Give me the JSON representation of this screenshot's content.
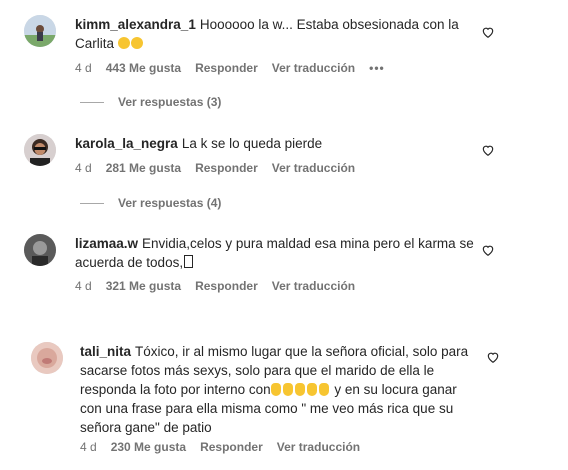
{
  "comments": [
    {
      "username": "kimm_alexandra_1",
      "text": "Hoooooo la w... Estaba obsesionada con la Carlita",
      "time": "4 d",
      "likes": "443 Me gusta",
      "reply": "Responder",
      "translate": "Ver traducción",
      "more": "•••",
      "view_replies": "Ver respuestas (3)"
    },
    {
      "username": "karola_la_negra",
      "text": "La k se lo queda pierde",
      "time": "4 d",
      "likes": "281 Me gusta",
      "reply": "Responder",
      "translate": "Ver traducción",
      "view_replies": "Ver respuestas (4)"
    },
    {
      "username": "lizamaa.w",
      "text": "Envidia,celos y pura maldad esa mina pero el karma se acuerda de todos,",
      "time": "4 d",
      "likes": "321 Me gusta",
      "reply": "Responder",
      "translate": "Ver traducción"
    },
    {
      "username": "tali_nita",
      "text_part1": "Tóxico, ir al mismo lugar que la señora oficial, solo para sacarse fotos más sexys, solo para que el marido de ella le responda la foto por interno con",
      "text_part2": " y en su locura ganar con una frase para ella misma como \" me veo más rica que su señora gane\" de patio",
      "time": "4 d",
      "likes": "230 Me gusta",
      "reply": "Responder",
      "translate": "Ver traducción"
    }
  ],
  "icons": {
    "heart": "heart-icon",
    "more": "more-options-icon"
  },
  "colors": {
    "text": "#262626",
    "secondary": "#737373",
    "emoji": "#f7c531"
  }
}
